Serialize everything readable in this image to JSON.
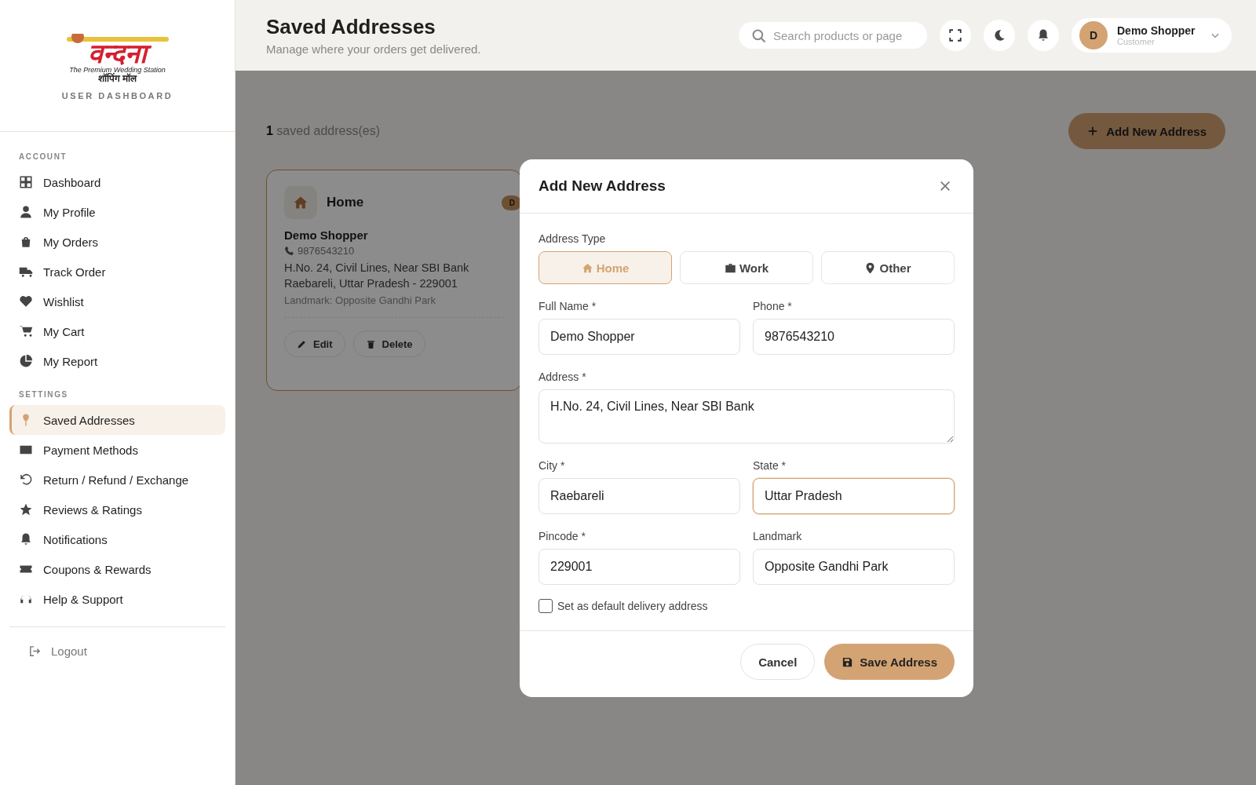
{
  "sidebar": {
    "logo": {
      "name": "वन्दना",
      "tagline": "The Premium Wedding Station",
      "subtitle": "शॉपिंग मॉल"
    },
    "caption": "USER DASHBOARD",
    "sections": [
      {
        "title": "ACCOUNT",
        "items": [
          {
            "label": "Dashboard",
            "selected": false
          },
          {
            "label": "My Profile",
            "selected": false
          },
          {
            "label": "My Orders",
            "selected": false
          },
          {
            "label": "Track Order",
            "selected": false
          },
          {
            "label": "Wishlist",
            "selected": false
          },
          {
            "label": "My Cart",
            "selected": false
          },
          {
            "label": "My Report",
            "selected": false
          }
        ]
      },
      {
        "title": "SETTINGS",
        "items": [
          {
            "label": "Saved Addresses",
            "selected": true
          },
          {
            "label": "Payment Methods",
            "selected": false
          },
          {
            "label": "Return / Refund / Exchange",
            "selected": false
          },
          {
            "label": "Reviews & Ratings",
            "selected": false
          },
          {
            "label": "Notifications",
            "selected": false
          },
          {
            "label": "Coupons & Rewards",
            "selected": false
          },
          {
            "label": "Help & Support",
            "selected": false
          }
        ]
      }
    ],
    "logout": "Logout"
  },
  "header": {
    "title": "Saved Addresses",
    "subtitle": "Manage where your orders get delivered.",
    "search": {
      "placeholder": "Search products or page"
    },
    "user": {
      "initial": "D",
      "name": "Demo Shopper",
      "role": "Customer"
    }
  },
  "content": {
    "count": "1",
    "count_label": "saved address(es)",
    "add_button": "Add New Address",
    "cards": [
      {
        "type": "Home",
        "badge": "D",
        "name": "Demo Shopper",
        "phone": "9876543210",
        "line1": "H.No. 24, Civil Lines, Near SBI Bank",
        "line2": "Raebareli, Uttar Pradesh - 229001",
        "landmark": "Landmark: Opposite Gandhi Park",
        "actions": [
          "Edit",
          "Delete"
        ]
      }
    ]
  },
  "modal": {
    "title": "Add New Address",
    "type_label": "Address Type",
    "types": [
      {
        "label": "Home",
        "selected": true
      },
      {
        "label": "Work",
        "selected": false
      },
      {
        "label": "Other",
        "selected": false
      }
    ],
    "fields": [
      {
        "kind": "input",
        "label": "Full Name *",
        "value": "Demo Shopper",
        "focused": false
      },
      {
        "kind": "input",
        "label": "Phone *",
        "value": "9876543210",
        "focused": false
      },
      {
        "kind": "textarea",
        "label": "Address *",
        "value": "H.No. 24, Civil Lines, Near SBI Bank",
        "focused": false
      },
      {
        "kind": "input",
        "label": "City *",
        "value": "Raebareli",
        "focused": false
      },
      {
        "kind": "input",
        "label": "State *",
        "value": "Uttar Pradesh",
        "focused": true
      },
      {
        "kind": "input",
        "label": "Pincode *",
        "value": "229001",
        "focused": false
      },
      {
        "kind": "input",
        "label": "Landmark",
        "value": "Opposite Gandhi Park",
        "focused": false
      }
    ],
    "default_checkbox": {
      "label": "Set as default delivery address",
      "checked": false
    },
    "cancel": "Cancel",
    "save": "Save Address"
  }
}
